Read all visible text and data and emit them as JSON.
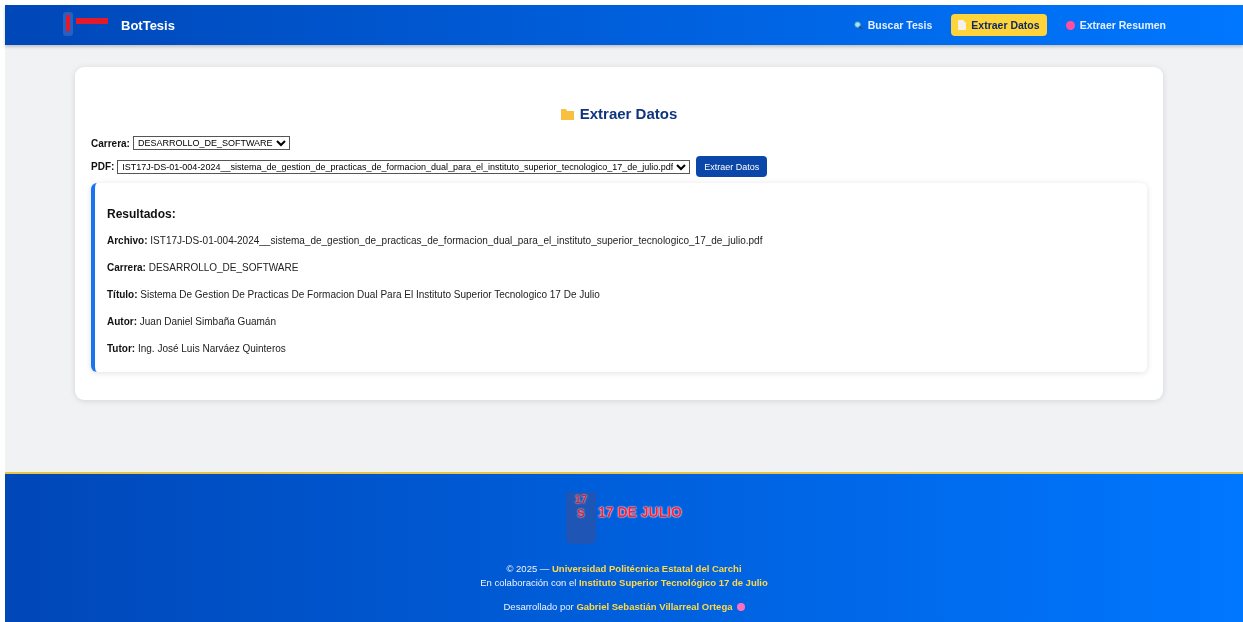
{
  "header": {
    "brand": "BotTesis",
    "nav": [
      {
        "label": "Buscar Tesis",
        "kind": "search",
        "selected": false
      },
      {
        "label": "Extraer Datos",
        "kind": "document",
        "selected": true
      },
      {
        "label": "Extraer Resumen",
        "kind": "dot",
        "selected": false
      }
    ]
  },
  "card": {
    "title": "Extraer Datos",
    "carrera": {
      "label": "Carrera:",
      "value": "DESARROLLO_DE_SOFTWARE"
    },
    "pdf": {
      "label": "PDF:",
      "value": "IST17J-DS-01-004-2024__sistema_de_gestion_de_practicas_de_formacion_dual_para_el_instituto_superior_tecnologico_17_de_julio.pdf"
    },
    "button": "Extraer Datos",
    "results": {
      "title": "Resultados:",
      "fields": [
        {
          "label": "Archivo:",
          "value": "IST17J-DS-01-004-2024__sistema_de_gestion_de_practicas_de_formacion_dual_para_el_instituto_superior_tecnologico_17_de_julio.pdf"
        },
        {
          "label": "Carrera:",
          "value": "DESARROLLO_DE_SOFTWARE"
        },
        {
          "label": "Título:",
          "value": "Sistema De Gestion De Practicas De Formacion Dual Para El Instituto Superior Tecnologico 17 De Julio"
        },
        {
          "label": "Autor:",
          "value": "Juan Daniel Simbaña Guamán"
        },
        {
          "label": "Tutor:",
          "value": "Ing. José Luis Narváez Quinteros"
        }
      ]
    }
  },
  "footer": {
    "logo": {
      "number": "17",
      "letter": "S",
      "name": "17 DE JULIO"
    },
    "lines": [
      "© 2025 — **Universidad Politécnica Estatal del Carchi**",
      "En colaboración con el **Instituto Superior Tecnológico 17 de Julio**"
    ],
    "credit": "Desarrollado por **Gabriel Sebastián Villarreal Ortega**"
  }
}
